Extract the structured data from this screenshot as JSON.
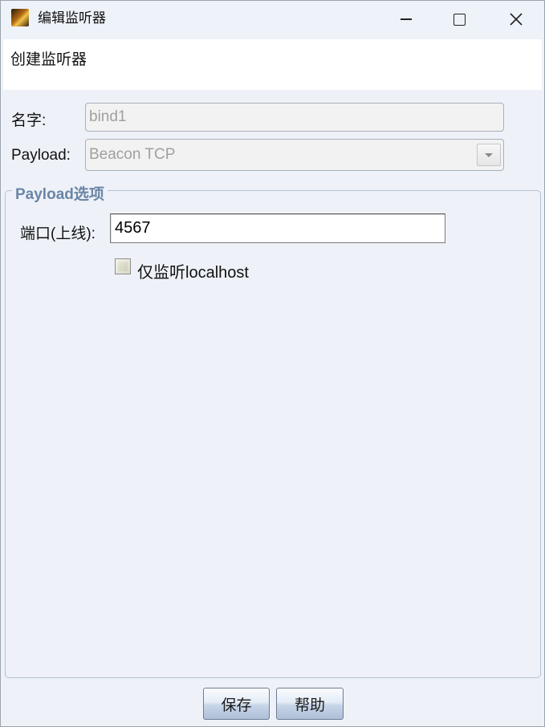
{
  "window": {
    "title": "编辑监听器",
    "icon": "app-icon"
  },
  "banner": {
    "text": "创建监听器"
  },
  "form": {
    "name_label": "名字:",
    "name_value": "bind1",
    "payload_label": "Payload:",
    "payload_value": "Beacon TCP"
  },
  "options": {
    "group_title": "Payload选项",
    "port_label": "端口(上线):",
    "port_value": "4567",
    "localhost_label": "仅监听localhost",
    "localhost_checked": false
  },
  "buttons": {
    "save": "保存",
    "help": "帮助"
  },
  "colors": {
    "group_title": "#6a85a6",
    "window_bg": "#eef2f8"
  }
}
